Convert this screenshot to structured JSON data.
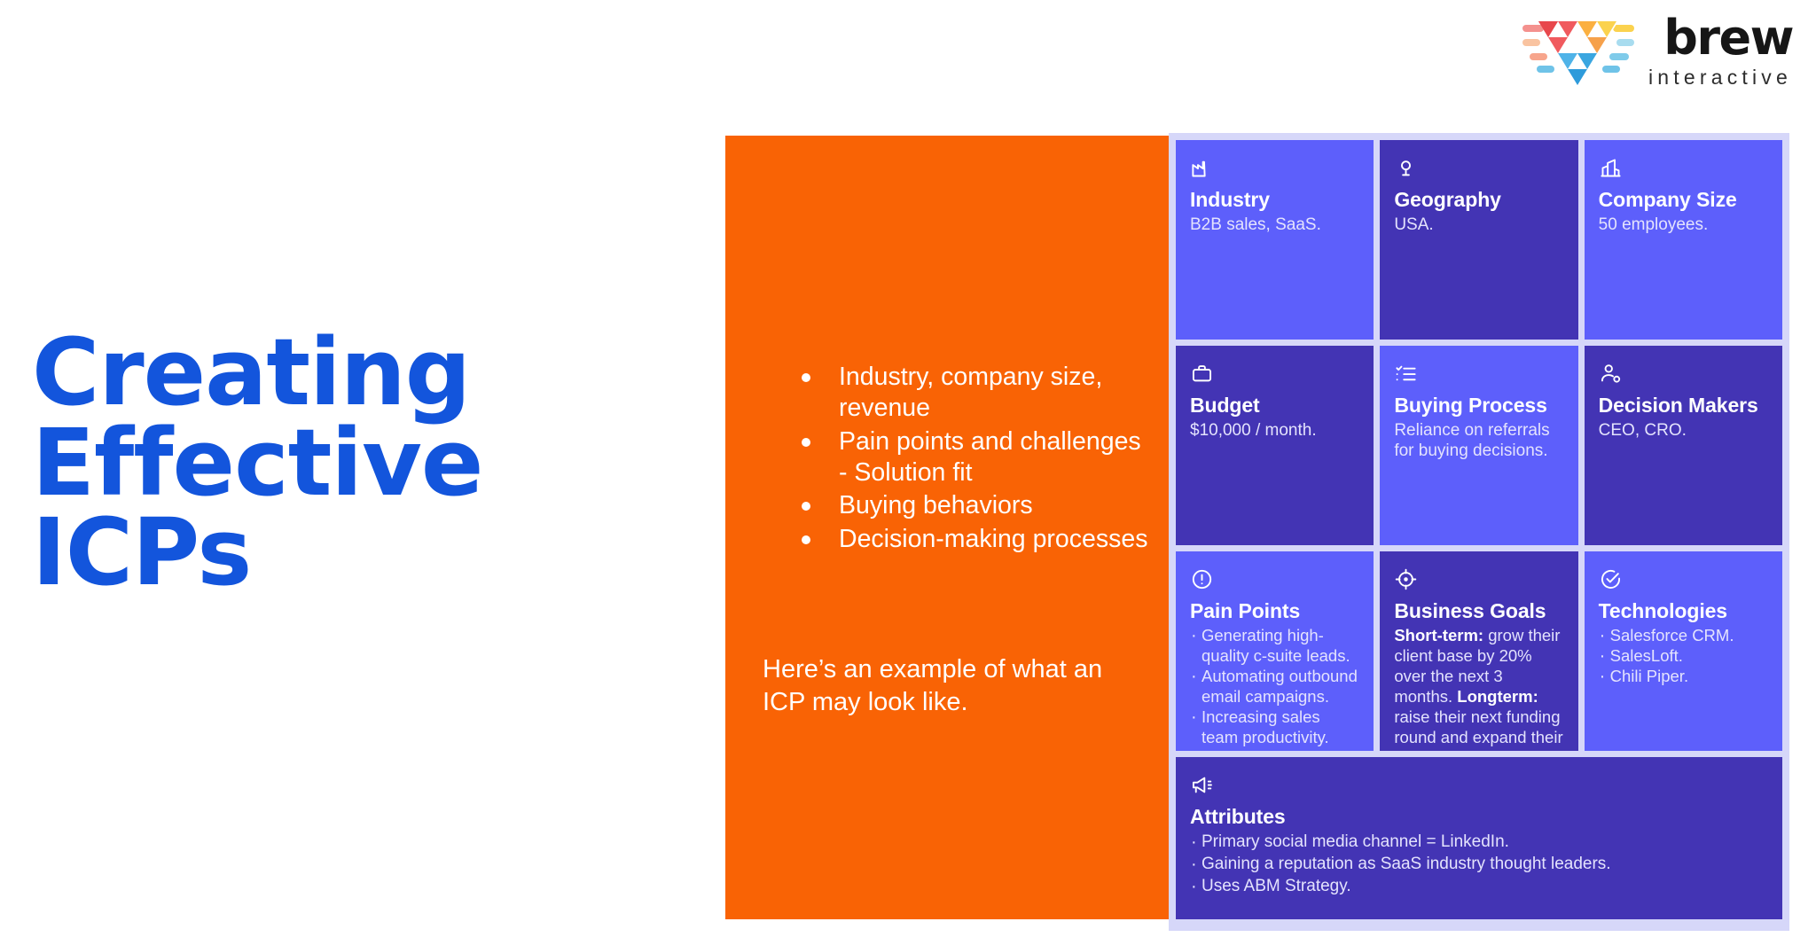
{
  "brand": {
    "logo_word": "brew",
    "logo_sub": "interactive",
    "logo_mark_icon": "brew-triangle-logo-icon",
    "accent_blue": "#1355DC",
    "accent_orange": "#F96305",
    "card_light": "#5D5FFB",
    "card_dark": "#4334B4",
    "panel_bg": "#D6D7F9"
  },
  "headline": {
    "text": "Creating\nEffective\nICPs"
  },
  "orange_panel": {
    "bullets": [
      "Industry, company size, revenue",
      "Pain points and challenges - Solution fit",
      "Buying behaviors",
      "Decision-making processes"
    ],
    "note": "Here’s an example of what an ICP may look like."
  },
  "icp_grid": {
    "rows": [
      {
        "cards": [
          {
            "id": "industry",
            "icon": "factory-icon",
            "title": "Industry",
            "sub": "B2B sales, SaaS.",
            "tone": "light"
          },
          {
            "id": "geography",
            "icon": "map-pin-icon",
            "title": "Geography",
            "sub": "USA.",
            "tone": "dark"
          },
          {
            "id": "company-size",
            "icon": "office-building-icon",
            "title": "Company Size",
            "sub": "50 employees.",
            "tone": "light"
          }
        ]
      },
      {
        "cards": [
          {
            "id": "budget",
            "icon": "briefcase-icon",
            "title": "Budget",
            "sub": "$10,000 / month.",
            "tone": "dark"
          },
          {
            "id": "buying-process",
            "icon": "checklist-icon",
            "title": "Buying Process",
            "sub": "Reliance on referrals for buying decisions.",
            "tone": "light"
          },
          {
            "id": "decision-makers",
            "icon": "user-settings-icon",
            "title": "Decision Makers",
            "sub": "CEO, CRO.",
            "tone": "dark"
          }
        ]
      },
      {
        "cards": [
          {
            "id": "pain-points",
            "icon": "alert-circle-icon",
            "title": "Pain Points",
            "tone": "light",
            "bullets": [
              "Generating high-quality c-suite leads.",
              "Automating outbound email campaigns.",
              "Increasing sales team productivity."
            ]
          },
          {
            "id": "business-goals",
            "icon": "target-icon",
            "title": "Business Goals",
            "tone": "dark",
            "paragraphs": [
              {
                "label": "Short-term:",
                "text": " grow their client base by 20% over the next 3 months."
              },
              {
                "label": "Longterm:",
                "text": " raise their next funding round and expand their sales team."
              }
            ]
          },
          {
            "id": "technologies",
            "icon": "check-circle-icon",
            "title": "Technologies",
            "tone": "light",
            "bullets": [
              "Salesforce CRM.",
              "SalesLoft.",
              "Chili Piper."
            ]
          }
        ]
      },
      {
        "cards": [
          {
            "id": "attributes",
            "icon": "megaphone-icon",
            "title": "Attributes",
            "tone": "dark",
            "wide": true,
            "bullets": [
              "Primary social media channel = LinkedIn.",
              "Gaining a reputation as SaaS industry thought leaders.",
              "Uses ABM Strategy."
            ]
          }
        ]
      }
    ]
  }
}
